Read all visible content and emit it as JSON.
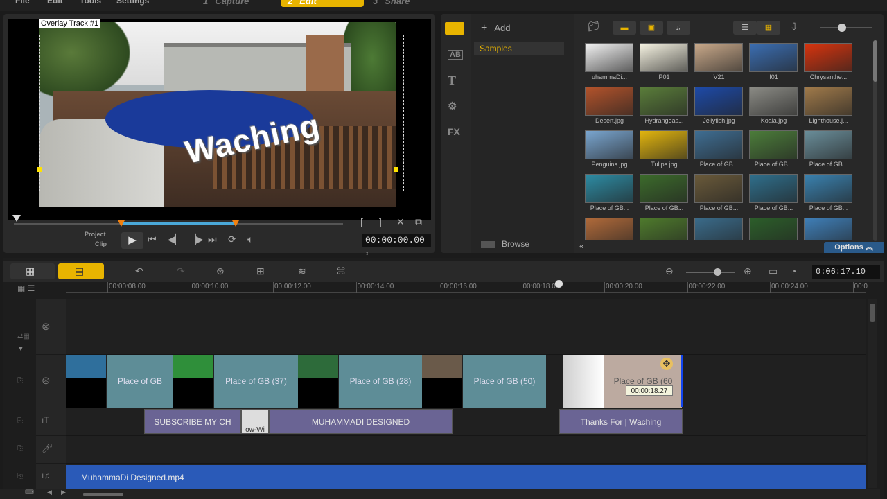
{
  "menu": {
    "file": "File",
    "edit": "Edit",
    "tools": "Tools",
    "settings": "Settings"
  },
  "steps": [
    {
      "num": "1",
      "label": "Capture"
    },
    {
      "num": "2",
      "label": "Edit"
    },
    {
      "num": "3",
      "label": "Share"
    }
  ],
  "preview": {
    "overlay_label": "Overlay Track #1",
    "overlay_text": "Waching",
    "mode_project": "Project",
    "mode_clip": "Clip",
    "timecode": "00:00:00.00",
    "scrub_progress": 0.68
  },
  "library": {
    "add_label": "Add",
    "folder": "Samples",
    "browse_label": "Browse",
    "options_label": "Options",
    "side_icons": [
      "media-icon",
      "transition-icon",
      "title-icon",
      "graphic-icon",
      "fx-icon"
    ],
    "fx_label": "FX",
    "ab_label": "AB",
    "t_label": "T",
    "thumbnails": [
      {
        "label": "uhammaDi...",
        "color": "#f2f2f2"
      },
      {
        "label": "P01",
        "color": "#f6f3e2"
      },
      {
        "label": "V21",
        "color": "#c9a98a"
      },
      {
        "label": "I01",
        "color": "#3b6eb2"
      },
      {
        "label": "Chrysanthe...",
        "color": "#d8340e"
      },
      {
        "label": "Desert.jpg",
        "color": "#b3532b"
      },
      {
        "label": "Hydrangeas...",
        "color": "#5a7d3a"
      },
      {
        "label": "Jellyfish.jpg",
        "color": "#1d4aa8"
      },
      {
        "label": "Koala.jpg",
        "color": "#8b8b85"
      },
      {
        "label": "Lighthouse.j...",
        "color": "#a07a4a"
      },
      {
        "label": "Penguins.jpg",
        "color": "#7aa6d0"
      },
      {
        "label": "Tulips.jpg",
        "color": "#e2b50e"
      },
      {
        "label": "Place of GB...",
        "color": "#3f6e93"
      },
      {
        "label": "Place of GB...",
        "color": "#4c7d3a"
      },
      {
        "label": "Place of GB...",
        "color": "#6a8e9a"
      },
      {
        "label": "Place of GB...",
        "color": "#2d8ca4"
      },
      {
        "label": "Place of GB...",
        "color": "#3c6b2b"
      },
      {
        "label": "Place of GB...",
        "color": "#6a5a3a"
      },
      {
        "label": "Place of GB...",
        "color": "#2f6f8c"
      },
      {
        "label": "Place of GB...",
        "color": "#3a82b0"
      },
      {
        "label": "",
        "color": "#b06a3a"
      },
      {
        "label": "",
        "color": "#4e7a2c"
      },
      {
        "label": "",
        "color": "#3a6b8a"
      },
      {
        "label": "",
        "color": "#2c5e2a"
      },
      {
        "label": "",
        "color": "#3f7fb8"
      }
    ]
  },
  "timeline": {
    "timecode": "0:06:17.10",
    "ruler": [
      "00:00:08.00",
      "00:00:10.00",
      "00:00:12.00",
      "00:00:14.00",
      "00:00:16.00",
      "00:00:18.00",
      "00:00:20.00",
      "00:00:22.00",
      "00:00:24.00",
      "00:0"
    ],
    "video_clips": [
      {
        "label": "Place of GB"
      },
      {
        "label": "Place of GB (37)"
      },
      {
        "label": "Place of GB (28)"
      },
      {
        "label": "Place of GB (50)"
      },
      {
        "label": "Place of GB (60"
      }
    ],
    "title_clips": [
      {
        "label": "SUBSCRIBE MY CH"
      },
      {
        "label": "ow-Wi"
      },
      {
        "label": "MUHAMMADI DESIGNED"
      },
      {
        "label": "Thanks For | Waching"
      }
    ],
    "music_clip": "MuhammaDi Designed.mp4",
    "duration_tip": "00:00:18.27"
  },
  "colors": {
    "accent": "#e8b400",
    "clip_teal": "#5e8d97",
    "title_purple": "#6a6494",
    "music_blue": "#2a5ab8",
    "options_blue": "#2a5a8a"
  }
}
